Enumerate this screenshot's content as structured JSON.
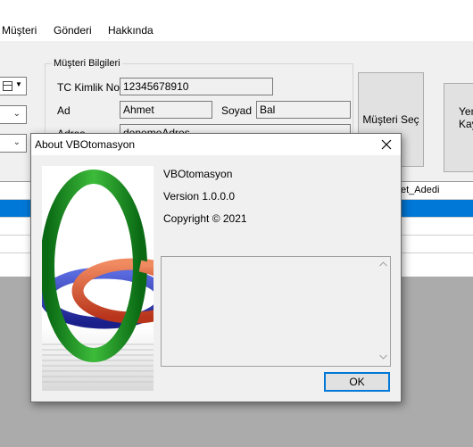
{
  "menu": {
    "items": [
      "Müşteri",
      "Gönderi",
      "Hakkında"
    ]
  },
  "customer_group": {
    "title": "Müşteri Bilgileri",
    "tc_label": "TC Kimlik No",
    "tc_value": "12345678910",
    "ad_label": "Ad",
    "ad_value": "Ahmet",
    "soyad_label": "Soyad",
    "soyad_value": "Bal",
    "adres_label": "Adres",
    "adres_value": "denemeAdres"
  },
  "buttons": {
    "musteri_sec": "Müşteri Seç",
    "yeni_kayit": "Yeni Kay"
  },
  "grid": {
    "visible_header": "et_Adedi",
    "selected_row_index": 1
  },
  "about": {
    "title": "About VBOtomasyon",
    "product_name": "VBOtomasyon",
    "version": "Version 1.0.0.0",
    "copyright": "Copyright ©  2021",
    "description": "",
    "ok_label": "OK",
    "close_icon": "close-icon",
    "logo_icon": "interlocked-rings-logo"
  },
  "colors": {
    "selection": "#0078d7",
    "ok_border": "#0078d7"
  }
}
